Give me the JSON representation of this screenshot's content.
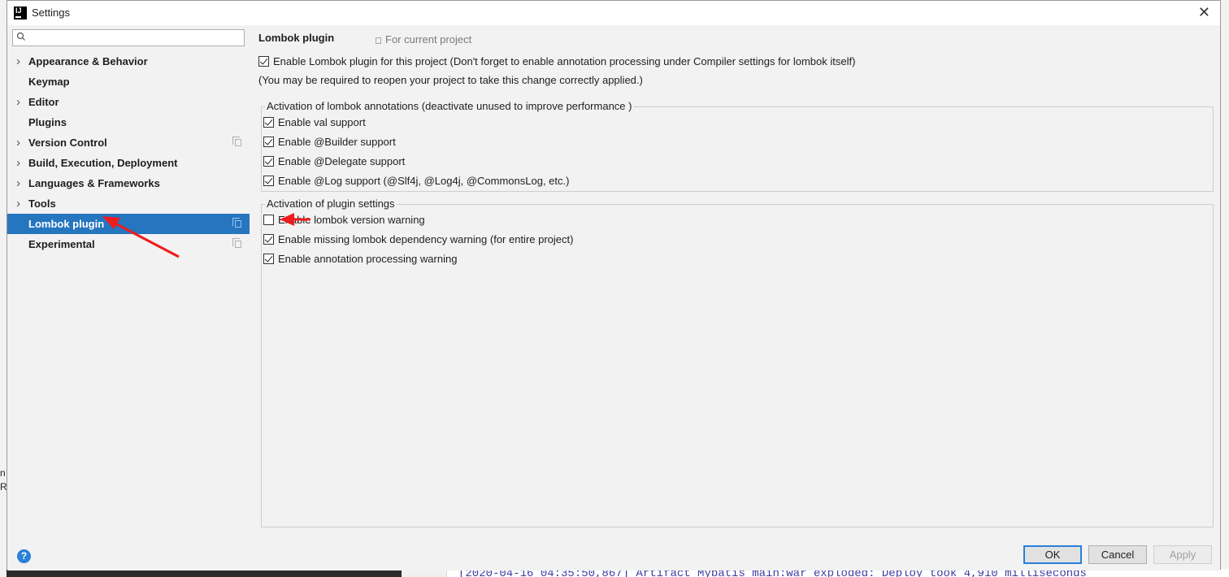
{
  "window": {
    "title": "Settings",
    "close_glyph": "✕",
    "logo_text": "IJ"
  },
  "search": {
    "placeholder": "",
    "icon": "search-icon"
  },
  "sidebar": {
    "items": [
      {
        "label": "Appearance & Behavior",
        "expandable": true,
        "selected": false,
        "copy_icon": false
      },
      {
        "label": "Keymap",
        "expandable": false,
        "selected": false,
        "copy_icon": false
      },
      {
        "label": "Editor",
        "expandable": true,
        "selected": false,
        "copy_icon": false
      },
      {
        "label": "Plugins",
        "expandable": false,
        "selected": false,
        "copy_icon": false
      },
      {
        "label": "Version Control",
        "expandable": true,
        "selected": false,
        "copy_icon": true
      },
      {
        "label": "Build, Execution, Deployment",
        "expandable": true,
        "selected": false,
        "copy_icon": false
      },
      {
        "label": "Languages & Frameworks",
        "expandable": true,
        "selected": false,
        "copy_icon": false
      },
      {
        "label": "Tools",
        "expandable": true,
        "selected": false,
        "copy_icon": false
      },
      {
        "label": "Lombok plugin",
        "expandable": false,
        "selected": true,
        "copy_icon": true
      },
      {
        "label": "Experimental",
        "expandable": false,
        "selected": false,
        "copy_icon": true
      }
    ]
  },
  "content": {
    "title": "Lombok plugin",
    "scope": "For current project",
    "enable_plugin": {
      "label": "Enable Lombok plugin for this project (Don't forget to enable annotation processing under Compiler settings for lombok itself)",
      "checked": true
    },
    "note": "(You may be required to reopen your project to take this change correctly applied.)",
    "annotations_group": {
      "title": "Activation of lombok annotations (deactivate unused to improve performance )",
      "options": [
        {
          "label": "Enable val support",
          "checked": true
        },
        {
          "label": "Enable @Builder support",
          "checked": true
        },
        {
          "label": "Enable @Delegate support",
          "checked": true
        },
        {
          "label": "Enable @Log support (@Slf4j, @Log4j, @CommonsLog, etc.)",
          "checked": true
        }
      ]
    },
    "plugin_group": {
      "title": "Activation of plugin settings",
      "options": [
        {
          "label": "Enable lombok version warning",
          "checked": false
        },
        {
          "label": "Enable missing lombok dependency warning (for entire project)",
          "checked": true
        },
        {
          "label": "Enable annotation processing warning",
          "checked": true
        }
      ]
    }
  },
  "footer": {
    "help": "?",
    "ok": "OK",
    "cancel": "Cancel",
    "apply": "Apply"
  },
  "background": {
    "log_line": "[2020-04-16 04:35:50,867] Artifact Mybatis_main:war exploded: Deploy took 4,910 milliseconds"
  },
  "colors": {
    "selection": "#2675bf",
    "accent": "#2a7fd6",
    "annotation_arrow": "#ee1c1c"
  }
}
